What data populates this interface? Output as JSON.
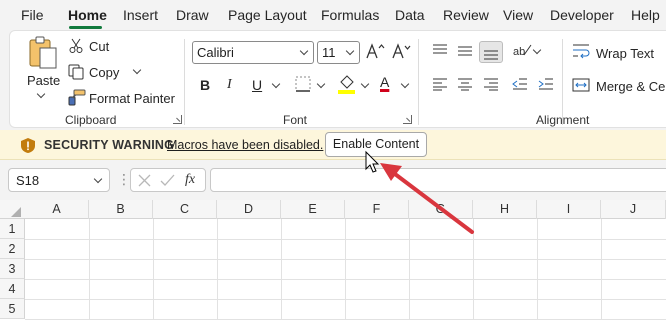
{
  "menu": {
    "tabs": [
      {
        "label": "File"
      },
      {
        "label": "Home"
      },
      {
        "label": "Insert"
      },
      {
        "label": "Draw"
      },
      {
        "label": "Page Layout"
      },
      {
        "label": "Formulas"
      },
      {
        "label": "Data"
      },
      {
        "label": "Review"
      },
      {
        "label": "View"
      },
      {
        "label": "Developer"
      },
      {
        "label": "Help"
      }
    ],
    "active_tab": "Home",
    "accent_color": "#117a3d"
  },
  "ribbon": {
    "clipboard": {
      "paste": "Paste",
      "cut": "Cut",
      "copy": "Copy",
      "format_painter": "Format Painter",
      "group_label": "Clipboard"
    },
    "font": {
      "font_name": "Calibri",
      "font_size": "11",
      "bold": "B",
      "italic": "I",
      "underline": "U",
      "font_color_letter": "A",
      "group_label": "Font"
    },
    "alignment": {
      "wrap_text": "Wrap Text",
      "merge_center": "Merge & Cen",
      "group_label": "Alignment"
    }
  },
  "security_bar": {
    "title": "SECURITY WARNING",
    "message": "Macros have been disabled.",
    "button": "Enable Content",
    "background": "#fdf6dc"
  },
  "formula_bar": {
    "name_box": "S18",
    "fx": "fx",
    "formula": ""
  },
  "grid": {
    "columns": [
      "A",
      "B",
      "C",
      "D",
      "E",
      "F",
      "G",
      "H",
      "I",
      "J"
    ],
    "rows": [
      "1",
      "2",
      "3",
      "4",
      "5"
    ]
  },
  "annotation": {
    "arrow_color": "#d9363e"
  }
}
